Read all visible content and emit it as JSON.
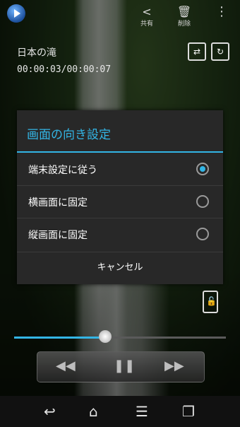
{
  "header": {
    "share_label": "共有",
    "delete_label": "削除"
  },
  "video": {
    "title": "日本の滝",
    "time": "00:00:03/00:00:07"
  },
  "dialog": {
    "title": "画面の向き設定",
    "options": [
      {
        "label": "端末設定に従う",
        "selected": true
      },
      {
        "label": "横画面に固定",
        "selected": false
      },
      {
        "label": "縦画面に固定",
        "selected": false
      }
    ],
    "cancel_label": "キャンセル"
  },
  "player": {
    "progress": 0.43
  },
  "colors": {
    "accent": "#33b5e5",
    "dialog_bg": "#282828"
  },
  "icons": {
    "share": "share-icon",
    "delete": "trash-icon",
    "overflow": "overflow-menu-icon",
    "repeat": "repeat-icon",
    "rotate": "rotate-icon",
    "lock": "lock-icon",
    "rewind": "rewind-icon",
    "pause": "pause-icon",
    "fast_forward": "fast-forward-icon",
    "back": "back-icon",
    "home": "home-icon",
    "menu": "menu-icon",
    "recent": "recent-apps-icon"
  }
}
